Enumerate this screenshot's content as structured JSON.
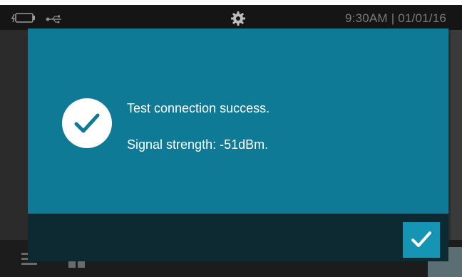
{
  "status_bar": {
    "clock": "9:30AM  |  01/01/16",
    "icons": [
      "battery-icon",
      "usb-icon",
      "settings-gear-icon"
    ]
  },
  "dialog": {
    "message": "Test connection success.",
    "signal_text": "Signal strength: -51dBm.",
    "success_icon": "checkmark-circle-icon",
    "ok_icon": "checkmark-icon"
  },
  "background": {
    "icons": [
      "menu-icon",
      "grid-icon",
      "confirm-icon"
    ]
  },
  "colors": {
    "dialog_bg": "#0e7a96",
    "dialog_footer_bg": "#0d2a33",
    "ok_button_bg": "#1694b4",
    "status_bar_bg": "#151515",
    "clock_text": "#7a7a7a"
  }
}
